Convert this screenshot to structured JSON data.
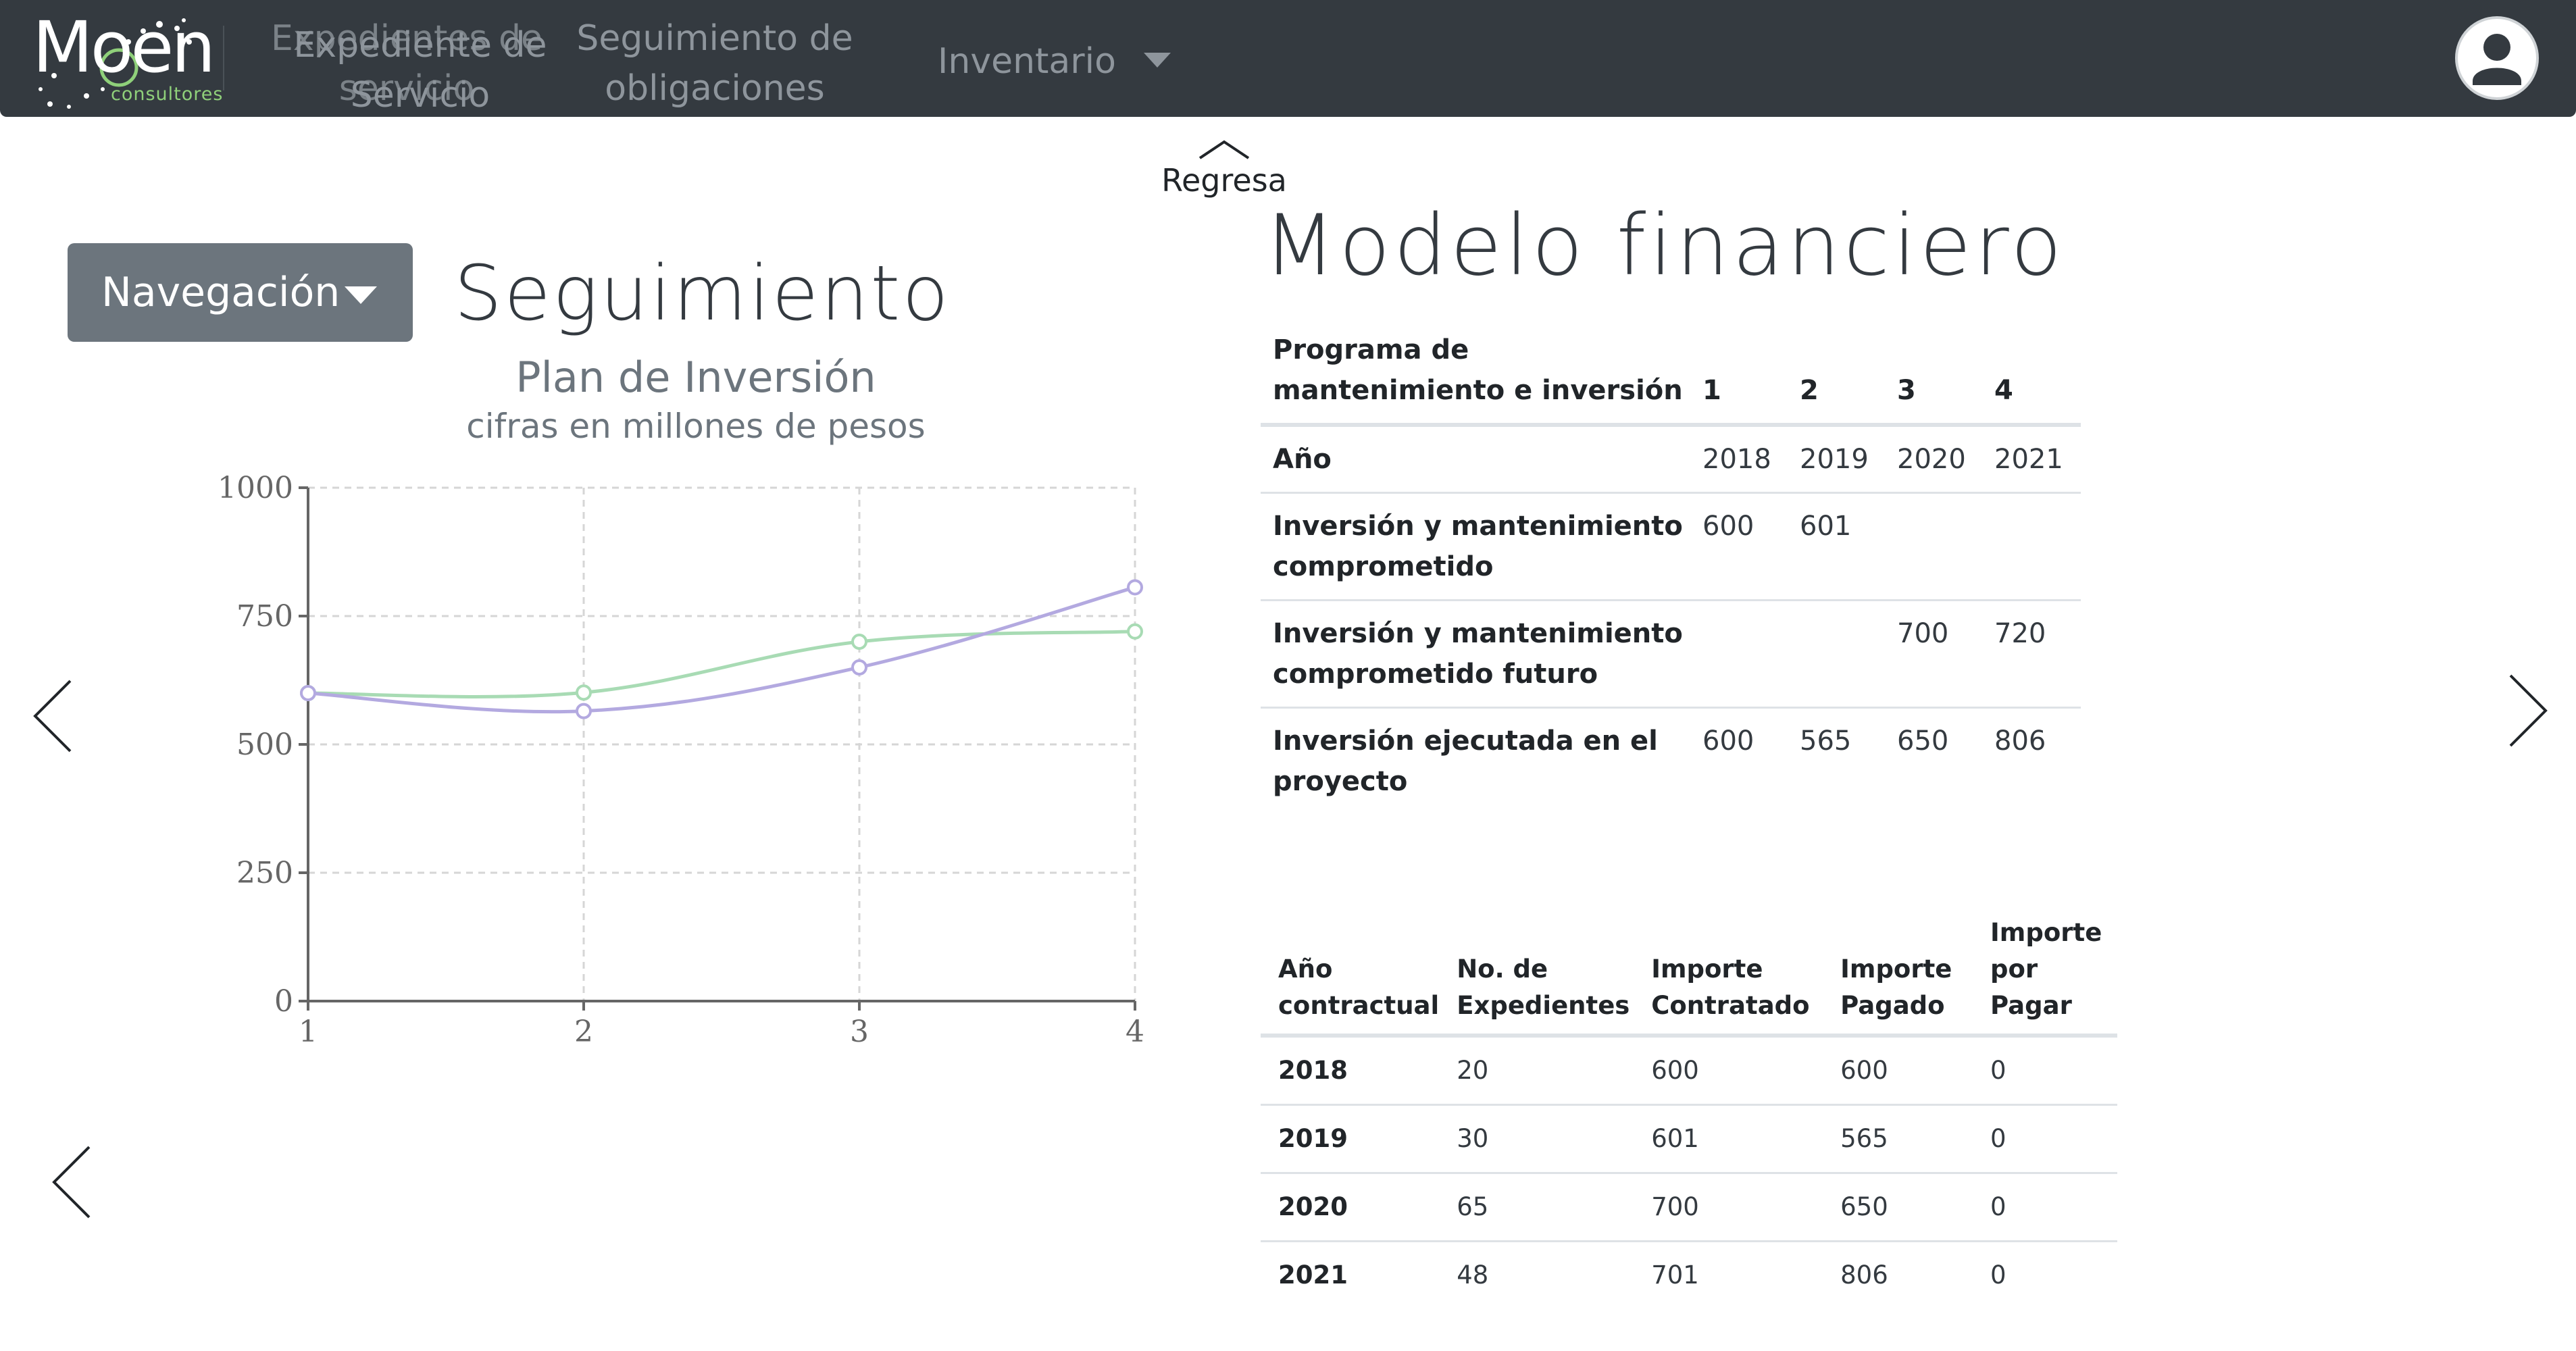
{
  "navbar": {
    "logo_text": "Moen",
    "logo_sub": "consultores",
    "links": {
      "expedientes": "Expedientes de servicio",
      "expediente": "Expediente de Servicio",
      "seguimiento_line1": "Seguimiento de",
      "seguimiento_line2": "obligaciones",
      "inventario": "Inventario"
    },
    "avatar_icon": "user-avatar-icon"
  },
  "left": {
    "navigation_button": "Navegación",
    "page_title": "Seguimiento"
  },
  "chart_data": {
    "type": "line",
    "title": "Plan de Inversión",
    "subtitle": "cifras en millones de pesos",
    "x": [
      1,
      2,
      3,
      4
    ],
    "series": [
      {
        "color": "#a8dbb4",
        "values": [
          600,
          601,
          700,
          720
        ]
      },
      {
        "color": "#b3a9e0",
        "values": [
          600,
          565,
          650,
          806
        ]
      }
    ],
    "xlim": [
      1,
      4
    ],
    "ylim": [
      0,
      1000
    ],
    "yticks": [
      0,
      250,
      500,
      750,
      1000
    ],
    "xticks": [
      1,
      2,
      3,
      4
    ],
    "grid": true
  },
  "right": {
    "back_label": "Regresa",
    "title": "Modelo financiero",
    "table1": {
      "header": [
        "Programa de mantenimiento e inversión",
        "1",
        "2",
        "3",
        "4"
      ],
      "rows": [
        [
          "Año",
          "2018",
          "2019",
          "2020",
          "2021"
        ],
        [
          "Inversión y mantenimiento comprometido",
          "600",
          "601",
          "",
          ""
        ],
        [
          "Inversión y mantenimiento comprometido futuro",
          "",
          "",
          "700",
          "720"
        ],
        [
          "Inversión ejecutada en el proyecto",
          "600",
          "565",
          "650",
          "806"
        ]
      ]
    },
    "table2": {
      "header": [
        "Año contractual",
        "No. de Expedientes",
        "Importe Contratado",
        "Importe Pagado",
        "Importe por Pagar"
      ],
      "rows": [
        [
          "2018",
          "20",
          "600",
          "600",
          "0"
        ],
        [
          "2019",
          "30",
          "601",
          "565",
          "0"
        ],
        [
          "2020",
          "65",
          "700",
          "650",
          "0"
        ],
        [
          "2021",
          "48",
          "701",
          "806",
          "0"
        ]
      ]
    }
  },
  "icons": {
    "prev": "chevron-left-icon",
    "next": "chevron-right-icon",
    "up": "chevron-up-icon",
    "dropdown": "caret-down-icon"
  }
}
